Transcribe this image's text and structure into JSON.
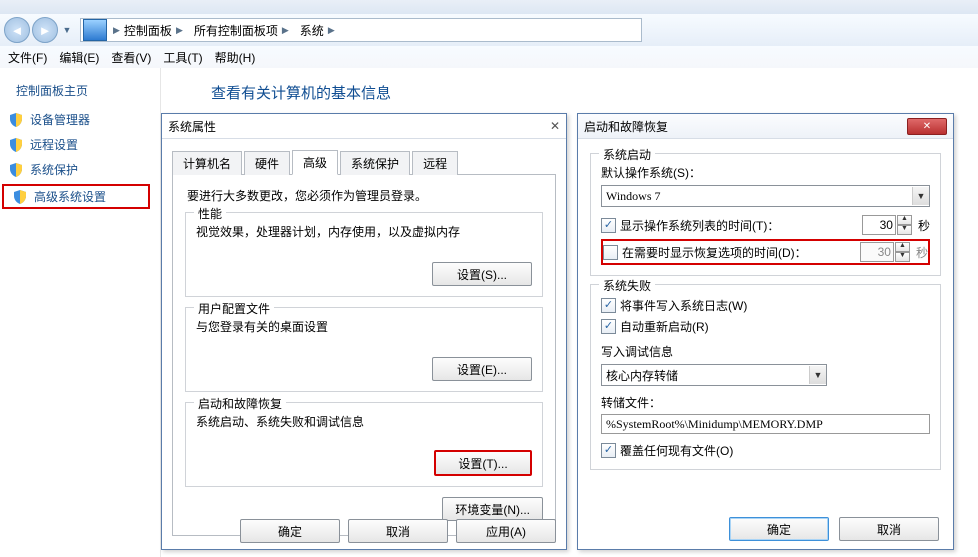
{
  "stray_title": "",
  "breadcrumb": {
    "seg1": "控制面板",
    "seg2": "所有控制面板项",
    "seg3": "系统"
  },
  "menu": {
    "file": "文件(F)",
    "edit": "编辑(E)",
    "view": "查看(V)",
    "tools": "工具(T)",
    "help": "帮助(H)"
  },
  "sidebar": {
    "header": "控制面板主页",
    "items": [
      {
        "label": "设备管理器"
      },
      {
        "label": "远程设置"
      },
      {
        "label": "系统保护"
      },
      {
        "label": "高级系统设置"
      }
    ]
  },
  "main": {
    "heading": "查看有关计算机的基本信息"
  },
  "sysprops": {
    "title": "系统属性",
    "close_hint": "✕",
    "tabs": {
      "computer_name": "计算机名",
      "hardware": "硬件",
      "advanced": "高级",
      "system_protection": "系统保护",
      "remote": "远程"
    },
    "admin_note": "要进行大多数更改，您必须作为管理员登录。",
    "perf": {
      "title": "性能",
      "desc": "视觉效果，处理器计划，内存使用，以及虚拟内存",
      "btn": "设置(S)..."
    },
    "profiles": {
      "title": "用户配置文件",
      "desc": "与您登录有关的桌面设置",
      "btn": "设置(E)..."
    },
    "startup": {
      "title": "启动和故障恢复",
      "desc": "系统启动、系统失败和调试信息",
      "btn": "设置(T)..."
    },
    "env_btn": "环境变量(N)...",
    "ok": "确定",
    "cancel": "取消",
    "apply": "应用(A)"
  },
  "startup_dlg": {
    "title": "启动和故障恢复",
    "boot": {
      "title": "系统启动",
      "default_os_label": "默认操作系统(S)：",
      "default_os_value": "Windows 7",
      "show_list_label": "显示操作系统列表的时间(T)：",
      "show_list_value": "30",
      "show_list_unit": "秒",
      "show_recover_label": "在需要时显示恢复选项的时间(D)：",
      "show_recover_value": "30",
      "show_recover_unit": "秒"
    },
    "fail": {
      "title": "系统失败",
      "write_log": "将事件写入系统日志(W)",
      "auto_restart": "自动重新启动(R)",
      "debug_label": "写入调试信息",
      "debug_value": "核心内存转储",
      "dump_label": "转储文件：",
      "dump_value": "%SystemRoot%\\Minidump\\MEMORY.DMP",
      "overwrite": "覆盖任何现有文件(O)"
    },
    "ok": "确定",
    "cancel": "取消"
  }
}
